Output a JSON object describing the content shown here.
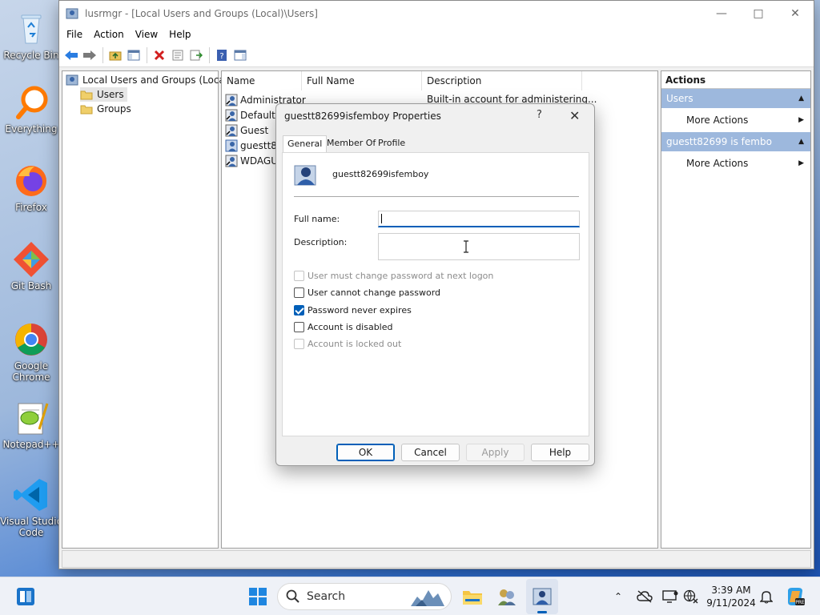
{
  "desktop": {
    "icons": [
      {
        "label": "Recycle Bin"
      },
      {
        "label": "Everything"
      },
      {
        "label": "Firefox"
      },
      {
        "label": "Git Bash"
      },
      {
        "label": "Google Chrome"
      },
      {
        "label": "Notepad++"
      },
      {
        "label": "Visual Studio Code"
      }
    ]
  },
  "window": {
    "title": "lusrmgr - [Local Users and Groups (Local)\\Users]",
    "menu": [
      "File",
      "Action",
      "View",
      "Help"
    ]
  },
  "tree": {
    "root": "Local Users and Groups (Local)",
    "items": [
      "Users",
      "Groups"
    ]
  },
  "list": {
    "columns": [
      "Name",
      "Full Name",
      "Description"
    ],
    "rows": [
      {
        "name": "Administrator",
        "description": "Built-in account for administering..."
      },
      {
        "name": "DefaultA"
      },
      {
        "name": "Guest"
      },
      {
        "name": "guestt82"
      },
      {
        "name": "WDAGUt"
      }
    ]
  },
  "actions": {
    "title": "Actions",
    "sections": [
      {
        "header": "Users",
        "item": "More Actions"
      },
      {
        "header": "guestt82699 is fembo",
        "item": "More Actions"
      }
    ]
  },
  "dialog": {
    "title": "guestt82699isfemboy Properties",
    "help_glyph": "?",
    "tabs": [
      "General",
      "Member Of",
      "Profile"
    ],
    "username": "guestt82699isfemboy",
    "full_name_label": "Full name:",
    "full_name_value": "",
    "description_label": "Description:",
    "description_value": "",
    "checkboxes": [
      {
        "label": "User must change password at next logon",
        "checked": false,
        "disabled": true
      },
      {
        "label": "User cannot change password",
        "checked": false,
        "disabled": false
      },
      {
        "label": "Password never expires",
        "checked": true,
        "disabled": false
      },
      {
        "label": "Account is disabled",
        "checked": false,
        "disabled": false
      },
      {
        "label": "Account is locked out",
        "checked": false,
        "disabled": true
      }
    ],
    "buttons": {
      "ok": "OK",
      "cancel": "Cancel",
      "apply": "Apply",
      "help": "Help"
    }
  },
  "taskbar": {
    "search_label": "Search",
    "time": "3:39 AM",
    "date": "9/11/2024"
  },
  "colors": {
    "accent": "#005fb8",
    "actions_header": "#9db8dd"
  }
}
